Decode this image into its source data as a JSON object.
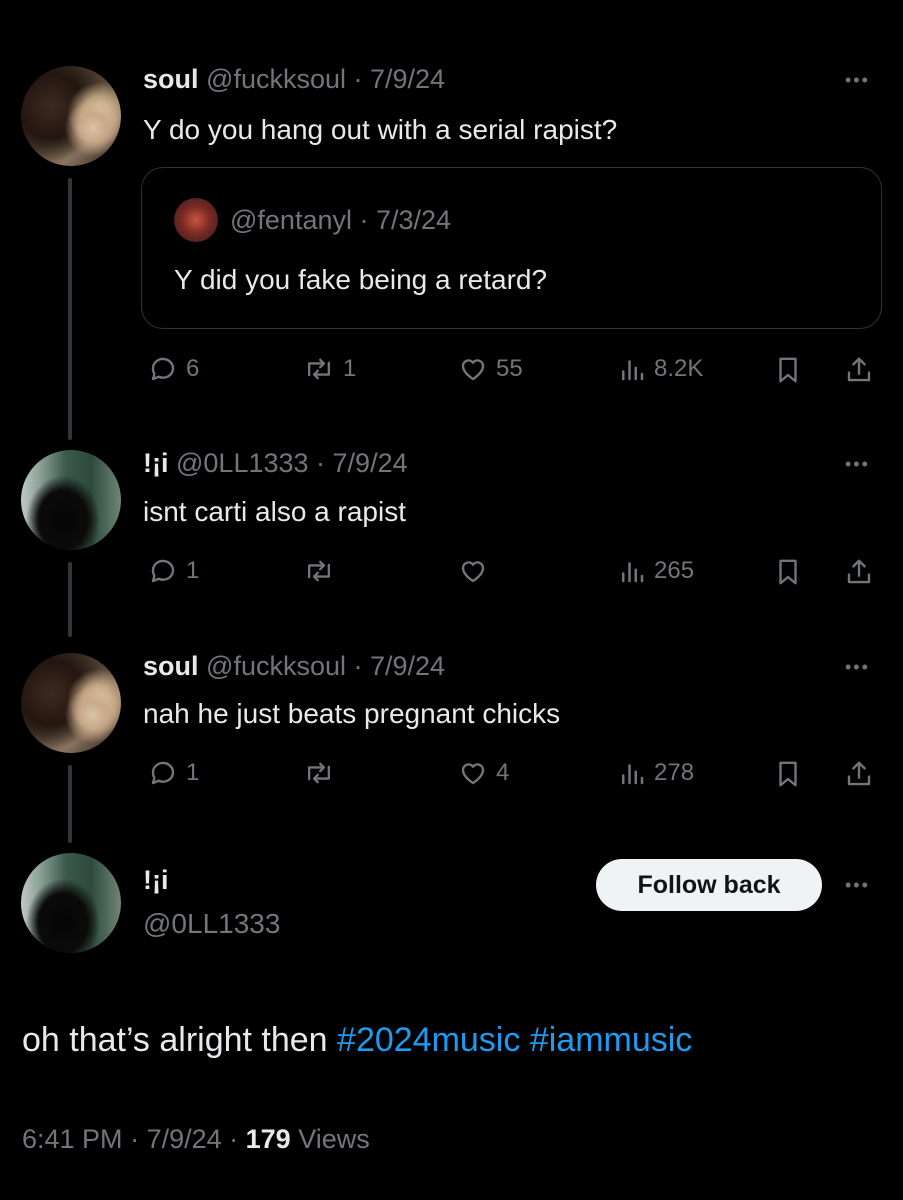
{
  "thread": [
    {
      "display_name": "soul",
      "handle": "@fuckksoul",
      "date": "7/9/24",
      "text": "Y do you hang out with a serial rapist?",
      "quote": {
        "handle": "@fentanyl",
        "date": "7/3/24",
        "text": "Y did you fake being a retard?"
      },
      "replies": "6",
      "reposts": "1",
      "likes": "55",
      "views": "8.2K"
    },
    {
      "display_name": "!¡i",
      "handle": "@0LL1333",
      "date": "7/9/24",
      "text": "isnt carti also a rapist",
      "replies": "1",
      "reposts": "",
      "likes": "",
      "views": "265"
    },
    {
      "display_name": "soul",
      "handle": "@fuckksoul",
      "date": "7/9/24",
      "text": "nah he just beats pregnant chicks",
      "replies": "1",
      "reposts": "",
      "likes": "4",
      "views": "278"
    }
  ],
  "main_post": {
    "display_name": "!¡i",
    "handle": "@0LL1333",
    "follow_label": "Follow back",
    "text": "oh that’s alright then ",
    "hashtags": [
      "#2024music",
      "#iammusic"
    ],
    "time": "6:41 PM",
    "date": "7/9/24",
    "views_count": "179",
    "views_label": "Views"
  },
  "ui": {
    "separator": " · ",
    "more_glyph": "•••"
  },
  "colors": {
    "background": "#000000",
    "text": "#e7e9ea",
    "secondary": "#71767b",
    "link": "#1d9bf0",
    "border": "#2f3336"
  },
  "icons": [
    "reply-icon",
    "repost-icon",
    "like-icon",
    "views-icon",
    "bookmark-icon",
    "share-icon",
    "more-icon"
  ]
}
